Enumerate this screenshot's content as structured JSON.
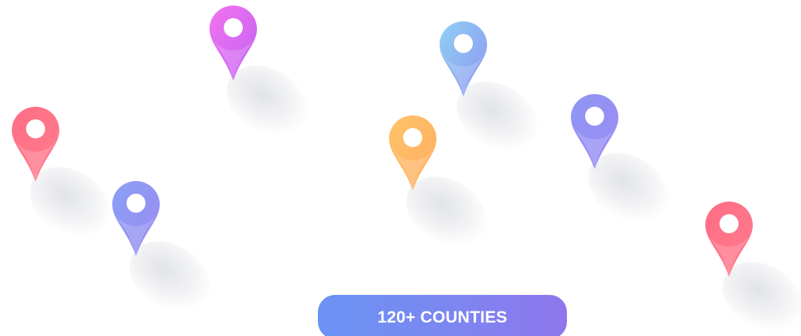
{
  "badge": {
    "label": "120+ COUNTIES"
  },
  "pins": [
    {
      "name": "location-pin-magenta",
      "colors": [
        "#f273f0",
        "#c163f2"
      ]
    },
    {
      "name": "location-pin-skyblue",
      "colors": [
        "#8fd0f4",
        "#8f95f1"
      ]
    },
    {
      "name": "location-pin-red-left",
      "colors": [
        "#ff6d84",
        "#ff7d8f"
      ]
    },
    {
      "name": "location-pin-orange",
      "colors": [
        "#ffc36a",
        "#ffad60"
      ]
    },
    {
      "name": "location-pin-blueviolet-right",
      "colors": [
        "#8f97f5",
        "#9c8af2"
      ]
    },
    {
      "name": "location-pin-blue-left",
      "colors": [
        "#8aa0f4",
        "#9a8af1"
      ]
    },
    {
      "name": "location-pin-red-right",
      "colors": [
        "#ff6d84",
        "#ff7b8d"
      ]
    }
  ],
  "colors": {
    "badge_gradient_start": "#6a93f4",
    "badge_gradient_end": "#9076ee",
    "background": "#ffffff"
  }
}
